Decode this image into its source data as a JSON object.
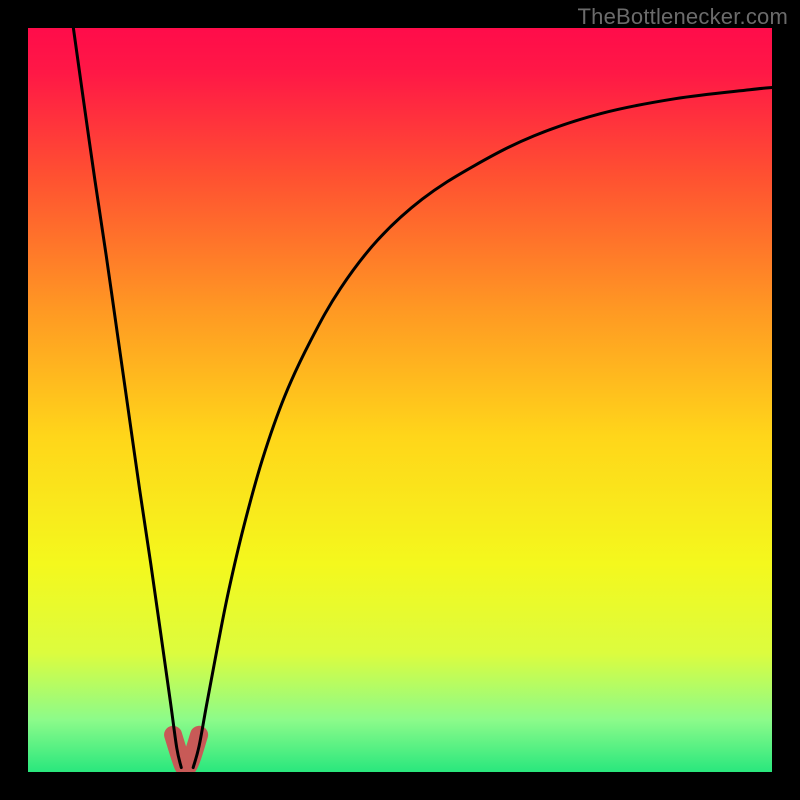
{
  "watermark": "TheBottlenecker.com",
  "chart_data": {
    "type": "line",
    "title": "",
    "xlabel": "",
    "ylabel": "",
    "xlim": [
      0,
      1
    ],
    "ylim": [
      0,
      1
    ],
    "gradient_stops": [
      {
        "offset": 0.0,
        "color": "#ff0c4a"
      },
      {
        "offset": 0.06,
        "color": "#ff1846"
      },
      {
        "offset": 0.2,
        "color": "#ff5131"
      },
      {
        "offset": 0.38,
        "color": "#ff9923"
      },
      {
        "offset": 0.55,
        "color": "#ffd61a"
      },
      {
        "offset": 0.72,
        "color": "#f4f81d"
      },
      {
        "offset": 0.84,
        "color": "#dcfc3e"
      },
      {
        "offset": 0.93,
        "color": "#8cfb8a"
      },
      {
        "offset": 1.0,
        "color": "#29e77d"
      }
    ],
    "series": [
      {
        "name": "left-branch",
        "x": [
          0.061,
          0.075,
          0.09,
          0.105,
          0.12,
          0.135,
          0.15,
          0.165,
          0.18,
          0.192,
          0.2,
          0.206
        ],
        "y": [
          1.0,
          0.9,
          0.795,
          0.695,
          0.59,
          0.485,
          0.38,
          0.28,
          0.175,
          0.09,
          0.032,
          0.006
        ]
      },
      {
        "name": "right-branch",
        "x": [
          0.222,
          0.23,
          0.24,
          0.255,
          0.27,
          0.29,
          0.315,
          0.345,
          0.38,
          0.42,
          0.47,
          0.53,
          0.6,
          0.68,
          0.77,
          0.87,
          0.97,
          1.0
        ],
        "y": [
          0.006,
          0.035,
          0.09,
          0.17,
          0.245,
          0.33,
          0.42,
          0.505,
          0.58,
          0.65,
          0.715,
          0.77,
          0.815,
          0.855,
          0.885,
          0.905,
          0.917,
          0.92
        ]
      }
    ],
    "trough": {
      "name": "trough-marker",
      "color": "#c85a57",
      "x": [
        0.195,
        0.205,
        0.21,
        0.214,
        0.22,
        0.23
      ],
      "y": [
        0.05,
        0.018,
        0.006,
        0.006,
        0.018,
        0.05
      ]
    }
  }
}
